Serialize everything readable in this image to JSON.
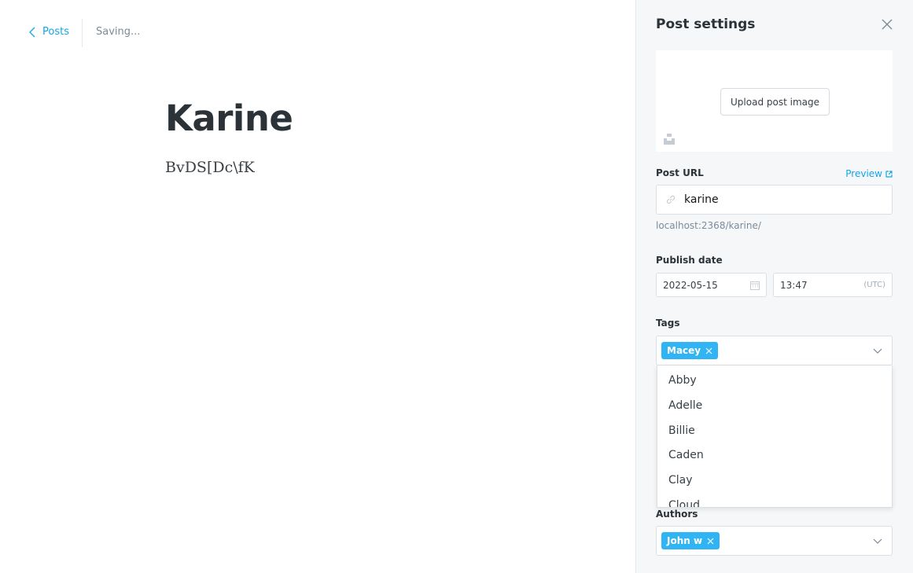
{
  "topbar": {
    "back_label": "Posts",
    "status": "Saving..."
  },
  "post": {
    "title": "Karine",
    "body": "BvDS[Dc\\fK"
  },
  "settings": {
    "title": "Post settings",
    "upload_label": "Upload post image",
    "post_url_label": "Post URL",
    "preview_label": "Preview",
    "slug": "karine",
    "url_hint": "localhost:2368/karine/",
    "publish_label": "Publish date",
    "date": "2022-05-15",
    "time": "13:47",
    "timezone": "(UTC)",
    "tags_label": "Tags",
    "tags": [
      "Macey"
    ],
    "tag_options": [
      "Abby",
      "Adelle",
      "Billie",
      "Caden",
      "Clay",
      "Cloud"
    ],
    "authors_label": "Authors",
    "authors": [
      "John w"
    ]
  },
  "colors": {
    "accent": "#14a5e6",
    "token": "#30b4f4",
    "title": "#2b3338"
  }
}
